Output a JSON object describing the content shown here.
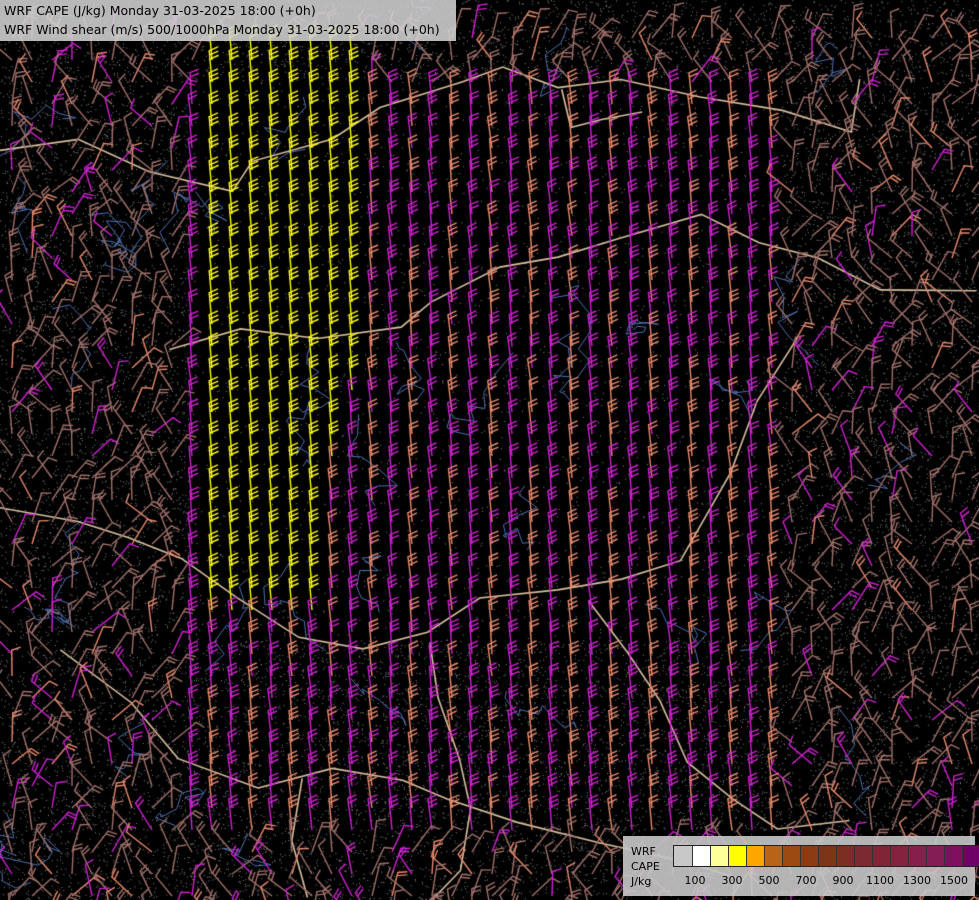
{
  "titles": {
    "line1": "WRF CAPE (J/kg) Monday 31-03-2025 18:00 (+0h)",
    "line2": "WRF Wind shear (m/s) 500/1000hPa Monday 31-03-2025 18:00 (+0h)"
  },
  "legend": {
    "label_line1": "WRF",
    "label_line2": "CAPE",
    "label_line3": "J/kg",
    "colors": [
      "#c8c8c8",
      "#ffffff",
      "#ffff99",
      "#ffff00",
      "#ffa500",
      "#b86418",
      "#9c4a12",
      "#8b3c14",
      "#7e3418",
      "#7a2f22",
      "#7a2a30",
      "#802538",
      "#842240",
      "#86204a",
      "#841c55",
      "#800f60",
      "#6e0068"
    ],
    "tick_labels": [
      "100",
      "300",
      "500",
      "700",
      "900",
      "1100",
      "1300",
      "1500"
    ]
  },
  "map_colors": {
    "background": "#000000",
    "barb_salmon": "#e88a6e",
    "barb_magenta": "#d020d0",
    "barb_yellow": "#ffff00",
    "barb_dusty": "#a0706a",
    "border_beige": "#d8c0a0",
    "river_blue": "#5070b0",
    "terrain_gray": "#888888"
  }
}
